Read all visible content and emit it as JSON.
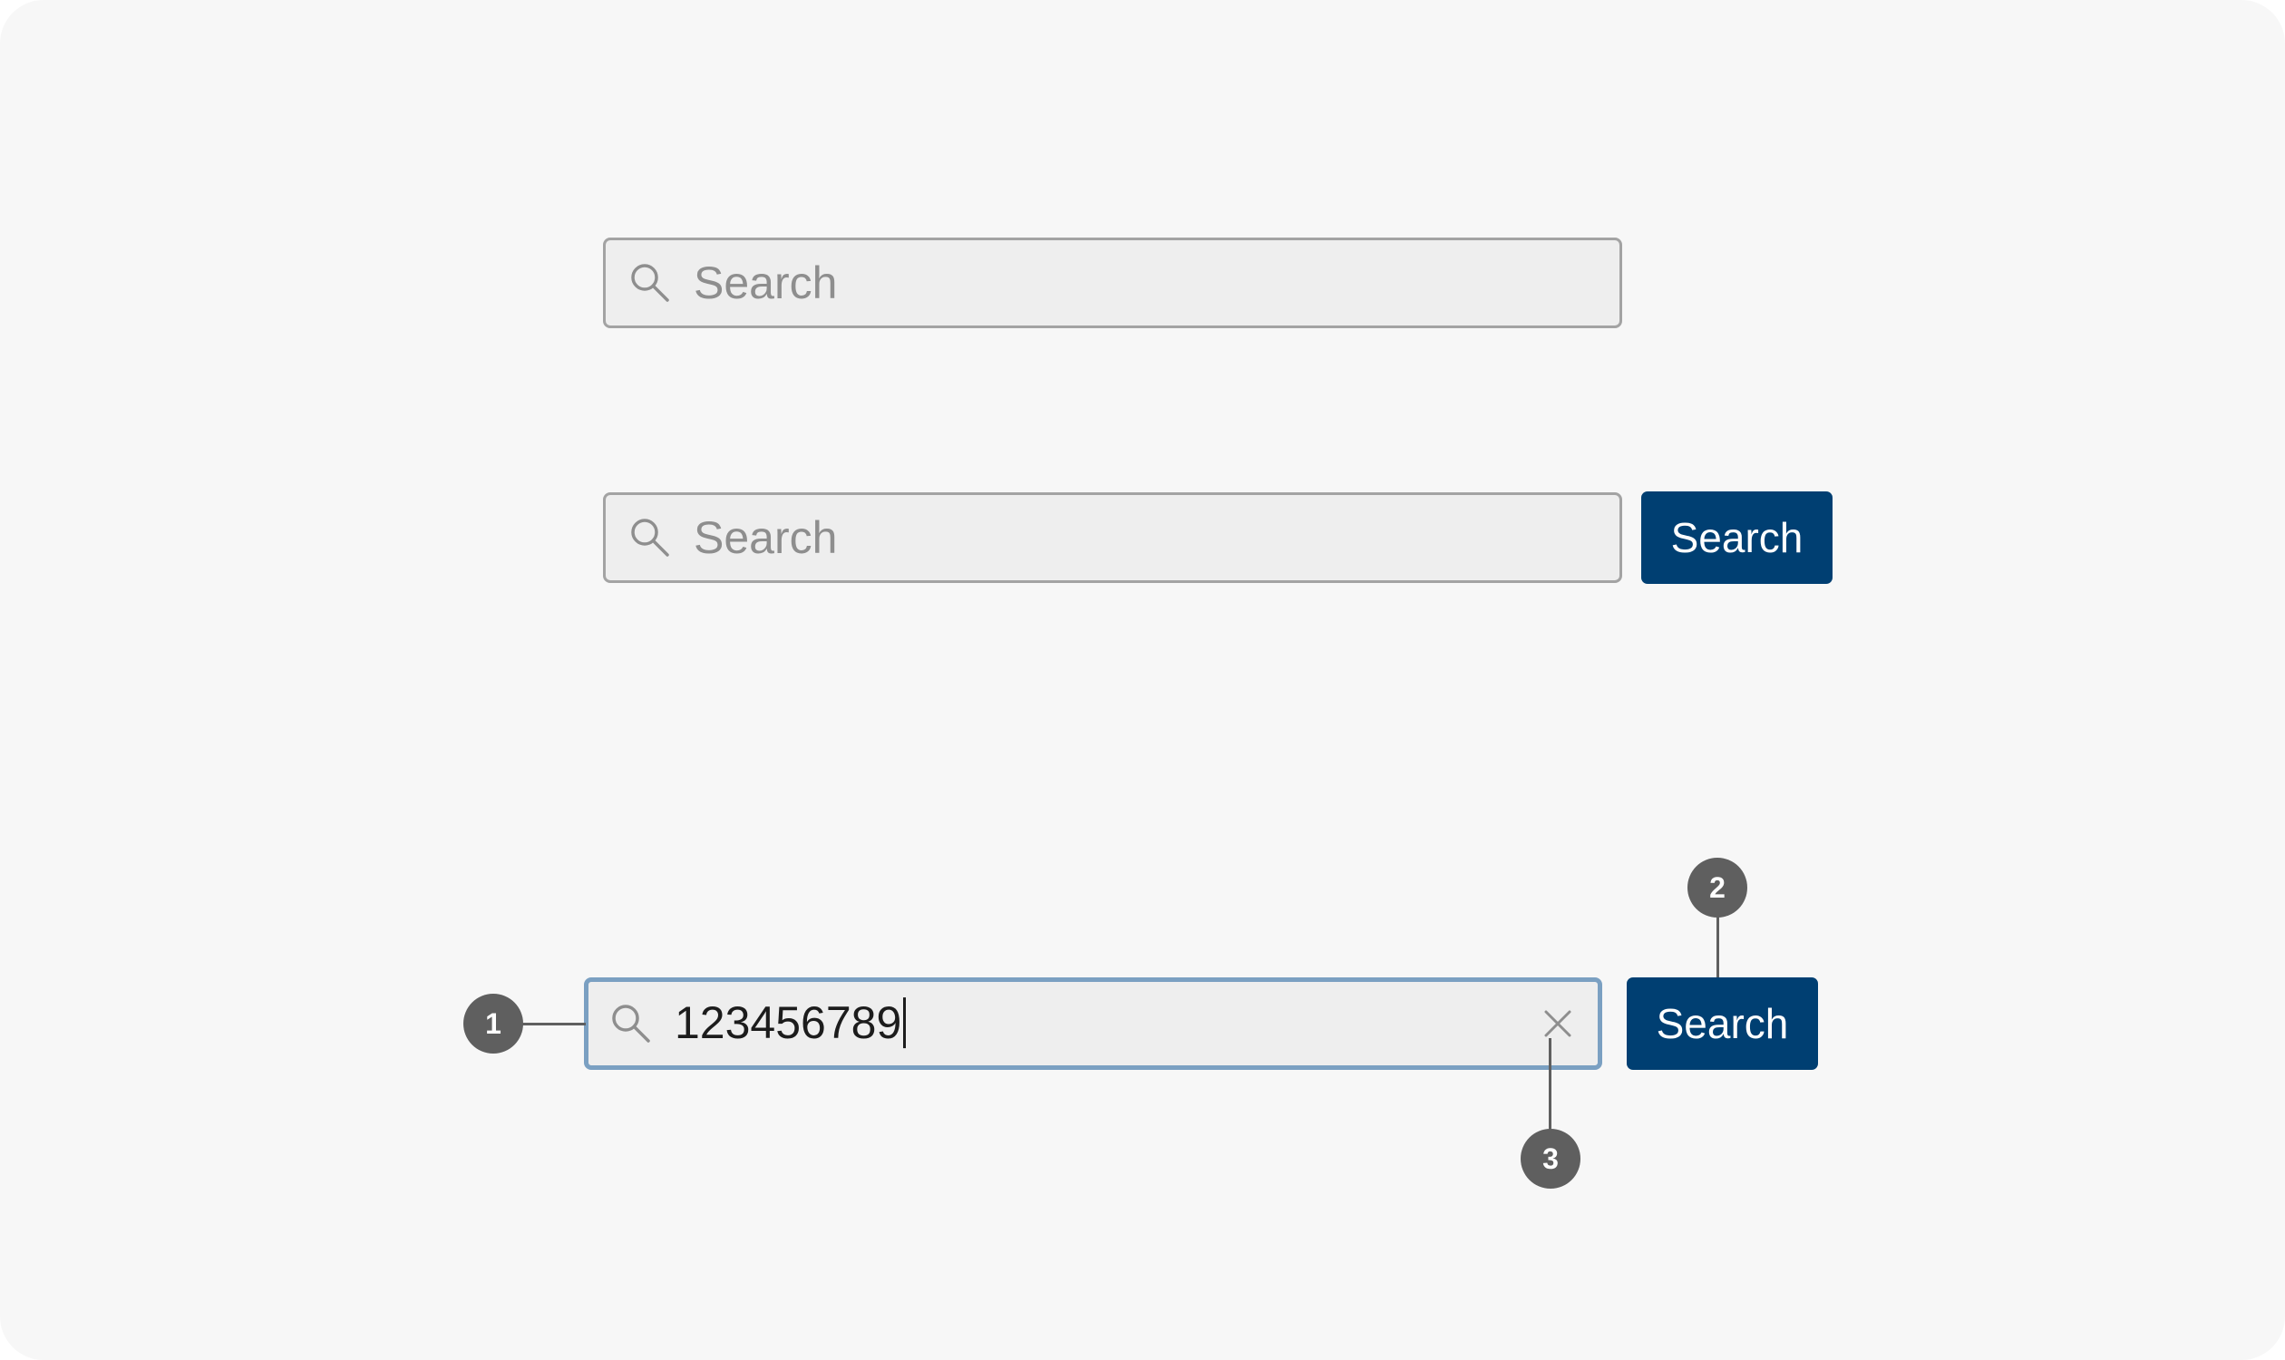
{
  "search_bar_basic": {
    "placeholder": "Search",
    "icon": "search-icon"
  },
  "search_bar_with_button": {
    "placeholder": "Search",
    "icon": "search-icon",
    "button_label": "Search"
  },
  "search_bar_annotated": {
    "value": "123456789",
    "icon": "search-icon",
    "clear_icon": "close-icon",
    "button_label": "Search",
    "callouts": [
      "1",
      "2",
      "3"
    ]
  },
  "colors": {
    "background": "#f7f7f7",
    "field_background": "#eeeeee",
    "field_border": "#a3a3a3",
    "field_border_focused": "#7ba0c2",
    "button_background": "#003f72",
    "button_text": "#ffffff",
    "placeholder_text": "#8e8e8e",
    "marker": "#5f5f5f"
  }
}
